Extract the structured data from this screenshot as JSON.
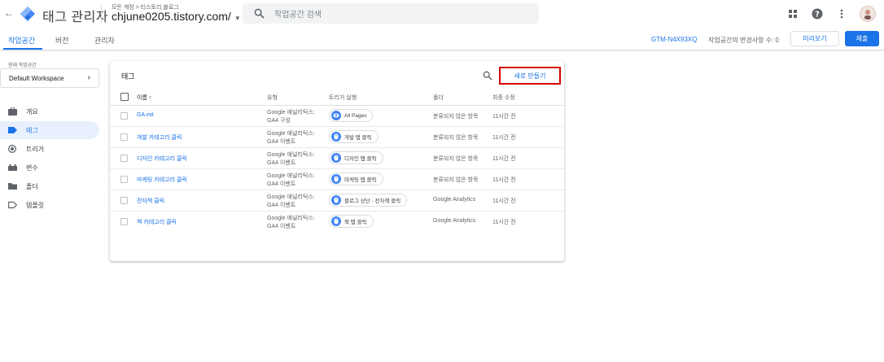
{
  "header": {
    "app_title": "태그 관리자",
    "breadcrumb": "모든 계정 > 티스토리 블로그",
    "container": "chjune0205.tistory.com/",
    "search_placeholder": "작업공간 검색"
  },
  "nav": {
    "tabs": [
      {
        "label": "작업공간"
      },
      {
        "label": "버전"
      },
      {
        "label": "관리자"
      }
    ],
    "gtm_id": "GTM-N4X93XQ",
    "changes_text": "작업공간의 변경사항 수: 0",
    "preview_label": "미리보기",
    "submit_label": "제출"
  },
  "sidebar": {
    "workspace_label": "현재 작업공간",
    "workspace_name": "Default Workspace",
    "items": [
      {
        "label": "개요",
        "icon": "briefcase-icon"
      },
      {
        "label": "태그",
        "icon": "tag-icon",
        "active": true
      },
      {
        "label": "트리거",
        "icon": "trigger-icon"
      },
      {
        "label": "변수",
        "icon": "variables-icon"
      },
      {
        "label": "폴더",
        "icon": "folder-icon"
      },
      {
        "label": "템플릿",
        "icon": "template-icon"
      }
    ]
  },
  "tags": {
    "title": "태그",
    "new_button": "새로 만들기",
    "columns": {
      "name": "이름 ↑",
      "type": "유형",
      "trigger": "트리거 실행",
      "folder": "폴더",
      "modified": "최종 수정"
    },
    "rows": [
      {
        "name": "GA init",
        "type1": "Google 애널리틱스:",
        "type2": "GA4 구성",
        "trigger": "All Pages",
        "trigger_icon": "eye-icon",
        "folder": "분류되지 않은 항목",
        "modified": "11시간 전"
      },
      {
        "name": "개발 카테고리 클릭",
        "type1": "Google 애널리틱스:",
        "type2": "GA4 이벤트",
        "trigger": "개발 탭 클릭",
        "trigger_icon": "click-icon",
        "folder": "분류되지 않은 항목",
        "modified": "11시간 전"
      },
      {
        "name": "디자인 카테고리 클릭",
        "type1": "Google 애널리틱스:",
        "type2": "GA4 이벤트",
        "trigger": "디자인 탭 클릭",
        "trigger_icon": "click-icon",
        "folder": "분류되지 않은 항목",
        "modified": "11시간 전"
      },
      {
        "name": "마케팅 카테고리 클릭",
        "type1": "Google 애널리틱스:",
        "type2": "GA4 이벤트",
        "trigger": "마케팅 탭 클릭",
        "trigger_icon": "click-icon",
        "folder": "분류되지 않은 항목",
        "modified": "11시간 전"
      },
      {
        "name": "전자책 클릭",
        "type1": "Google 애널리틱스:",
        "type2": "GA4 이벤트",
        "trigger": "블로그 상단 - 전자책 클릭",
        "trigger_icon": "click-icon",
        "folder": "Google Analytics",
        "modified": "11시간 전"
      },
      {
        "name": "책 카테고리 클릭",
        "type1": "Google 애널리틱스:",
        "type2": "GA4 이벤트",
        "trigger": "책 탭 클릭",
        "trigger_icon": "click-icon",
        "folder": "Google Analytics",
        "modified": "11시간 전"
      }
    ]
  },
  "colors": {
    "accent": "#1a73e8",
    "highlight_border": "#d50000"
  }
}
